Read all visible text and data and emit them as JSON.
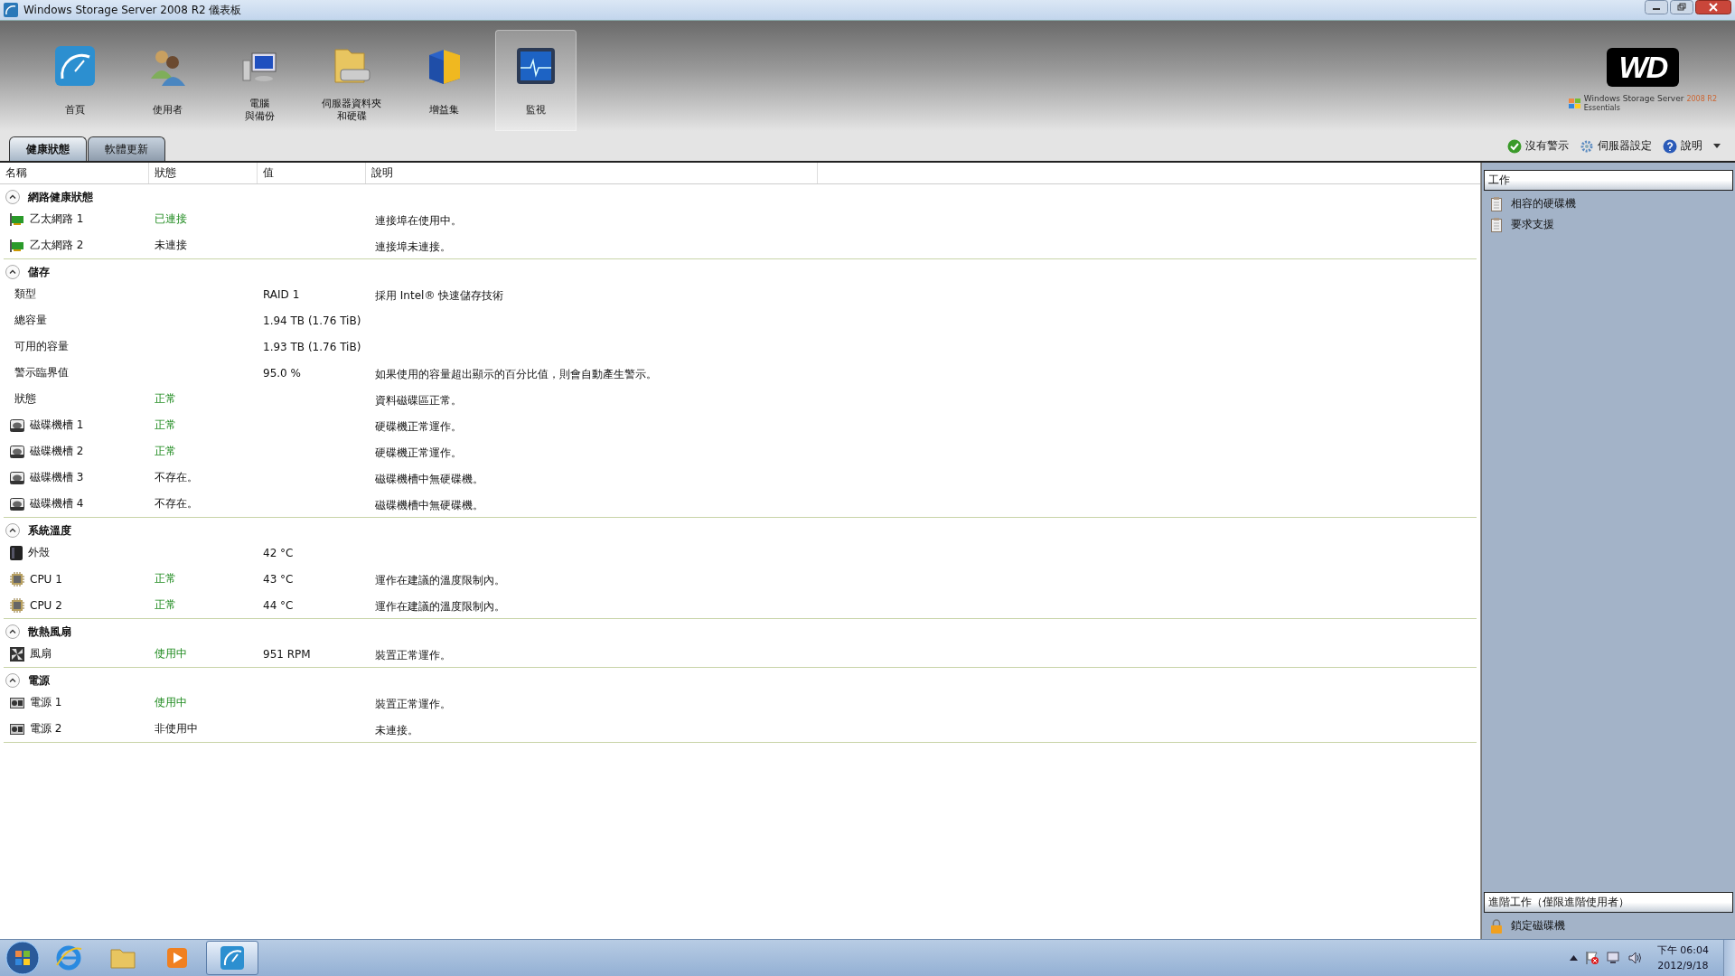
{
  "window": {
    "title": "Windows Storage Server 2008 R2 儀表板"
  },
  "nav": [
    {
      "label": "首頁",
      "kind": "home",
      "selected": false
    },
    {
      "label": "使用者",
      "kind": "users",
      "selected": false
    },
    {
      "label": "電腦",
      "label_line_2": "與備份",
      "kind": "computer",
      "selected": false
    },
    {
      "label": "伺服器資料夾",
      "label_line_2": "和硬碟",
      "kind": "folder",
      "selected": false
    },
    {
      "label": "增益集",
      "kind": "addin",
      "selected": false
    },
    {
      "label": "監視",
      "kind": "monitor",
      "selected": true
    }
  ],
  "logo": {
    "mark": "WD",
    "caption": "Windows Storage Server",
    "version": "2008 R2",
    "edition": "Essentials"
  },
  "tabs": [
    {
      "label": "健康狀態",
      "selected": true
    },
    {
      "label": "軟體更新",
      "selected": false
    }
  ],
  "header_links": [
    {
      "label": "沒有警示",
      "kind": "ok"
    },
    {
      "label": "伺服器設定",
      "kind": "gear"
    },
    {
      "label": "說明",
      "kind": "help"
    }
  ],
  "table": {
    "columns": [
      "名稱",
      "狀態",
      "值",
      "說明"
    ],
    "groups": [
      {
        "title": "網路健康狀態",
        "expanded": true,
        "rows": [
          {
            "kind": "network",
            "name": "乙太網路 1",
            "status": "已連接",
            "ok": true,
            "description": "連接埠在使用中。"
          },
          {
            "kind": "network",
            "name": "乙太網路 2",
            "status": "未連接",
            "ok": false,
            "description": "連接埠未連接。"
          }
        ]
      },
      {
        "title": "儲存",
        "expanded": true,
        "rows": [
          {
            "kind": "plain",
            "name": "類型",
            "value": "RAID 1",
            "description": "採用 Intel® 快速儲存技術"
          },
          {
            "kind": "plain",
            "name": "總容量",
            "value": "1.94 TB (1.76 TiB)"
          },
          {
            "kind": "plain",
            "name": "可用的容量",
            "value": "1.93 TB (1.76 TiB)"
          },
          {
            "kind": "plain",
            "name": "警示臨界值",
            "value": "95.0 %",
            "description": "如果使用的容量超出顯示的百分比值，則會自動產生警示。"
          },
          {
            "kind": "plain",
            "name": "狀態",
            "status": "正常",
            "ok": true,
            "description": "資料磁碟區正常。"
          },
          {
            "kind": "disk",
            "name": "磁碟機槽 1",
            "status": "正常",
            "ok": true,
            "description": "硬碟機正常運作。"
          },
          {
            "kind": "disk",
            "name": "磁碟機槽 2",
            "status": "正常",
            "ok": true,
            "description": "硬碟機正常運作。"
          },
          {
            "kind": "disk",
            "name": "磁碟機槽 3",
            "status": "不存在。",
            "ok": false,
            "description": "磁碟機槽中無硬碟機。"
          },
          {
            "kind": "disk",
            "name": "磁碟機槽 4",
            "status": "不存在。",
            "ok": false,
            "description": "磁碟機槽中無硬碟機。"
          }
        ]
      },
      {
        "title": "系統溫度",
        "expanded": true,
        "rows": [
          {
            "kind": "case",
            "name": "外殼",
            "value": "42 °C"
          },
          {
            "kind": "cpu",
            "name": "CPU 1",
            "status": "正常",
            "ok": true,
            "value": "43 °C",
            "description": "運作在建議的溫度限制內。"
          },
          {
            "kind": "cpu",
            "name": "CPU 2",
            "status": "正常",
            "ok": true,
            "value": "44 °C",
            "description": "運作在建議的溫度限制內。"
          }
        ]
      },
      {
        "title": "散熱風扇",
        "expanded": true,
        "rows": [
          {
            "kind": "fan",
            "name": "風扇",
            "status": "使用中",
            "ok": true,
            "value": "951 RPM",
            "description": "裝置正常運作。"
          }
        ]
      },
      {
        "title": "電源",
        "expanded": true,
        "rows": [
          {
            "kind": "power",
            "name": "電源 1",
            "status": "使用中",
            "ok": true,
            "description": "裝置正常運作。"
          },
          {
            "kind": "power",
            "name": "電源 2",
            "status": "非使用中",
            "ok": false,
            "description": "未連接。"
          }
        ]
      }
    ]
  },
  "tasks": {
    "title": "工作",
    "items": [
      {
        "label": "相容的硬碟機",
        "kind": "doc"
      },
      {
        "label": "要求支援",
        "kind": "doc"
      }
    ]
  },
  "advanced_tasks": {
    "title": "進階工作（僅限進階使用者）",
    "items": [
      {
        "label": "鎖定磁碟機",
        "kind": "lock"
      }
    ]
  },
  "taskbar": {
    "apps": [
      {
        "kind": "browser",
        "selected": false
      },
      {
        "kind": "explorer",
        "selected": false
      },
      {
        "kind": "media",
        "selected": false
      },
      {
        "kind": "dashboard",
        "selected": true
      }
    ],
    "time": "下午 06:04",
    "date": "2012/9/18"
  }
}
